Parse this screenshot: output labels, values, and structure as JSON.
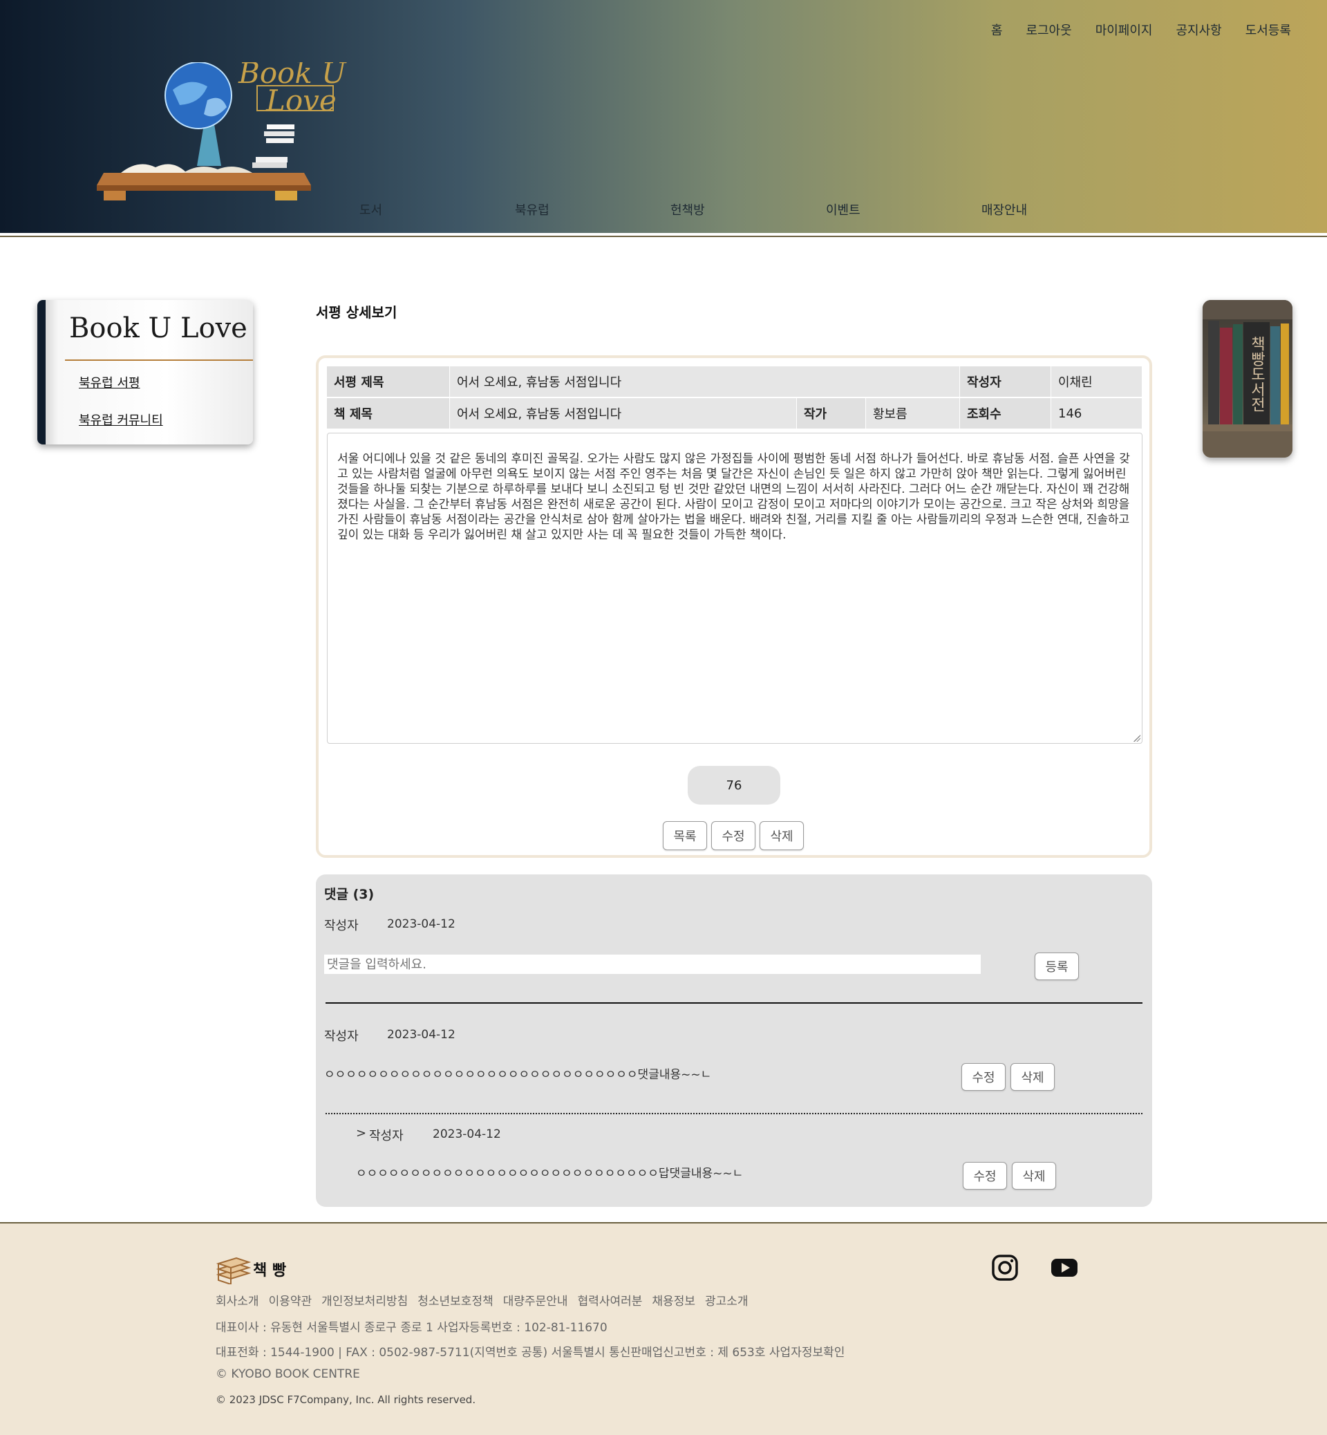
{
  "topnav": [
    "홈",
    "로그아웃",
    "마이페이지",
    "공지사항",
    "도서등록"
  ],
  "mainnav": [
    "도서",
    "북유럽",
    "헌책방",
    "이벤트",
    "매장안내"
  ],
  "logo": {
    "line1": "Book U",
    "line2": "Love"
  },
  "sidebar": {
    "title": "Book U Love",
    "items": [
      "북유럽 서평",
      "북유럽 커뮤니티"
    ]
  },
  "banner": {
    "title": "책빵도서전"
  },
  "page_title": "서평 상세보기",
  "review": {
    "review_title_label": "서평 제목",
    "review_title": "어서 오세요, 휴남동 서점입니다",
    "author_label": "작성자",
    "author": "이채린",
    "book_title_label": "책 제목",
    "book_title": "어서 오세요, 휴남동 서점입니다",
    "writer_label": "작가",
    "writer": "황보름",
    "views_label": "조회수",
    "views": "146",
    "body": "서울 어디에나 있을 것 같은 동네의 후미진 골목길. 오가는 사람도 많지 않은 가정집들 사이에 평범한 동네 서점 하나가 들어선다. 바로 휴남동 서점. 슬픈 사연을 갖고 있는 사람처럼 얼굴에 아무런 의욕도 보이지 않는 서점 주인 영주는 처음 몇 달간은 자신이 손님인 듯 일은 하지 않고 가만히 앉아 책만 읽는다. 그렇게 잃어버린 것들을 하나둘 되찾는 기분으로 하루하루를 보내다 보니 소진되고 텅 빈 것만 같았던 내면의 느낌이 서서히 사라진다. 그러다 어느 순간 깨닫는다. 자신이 꽤 건강해졌다는 사실을. 그 순간부터 휴남동 서점은 완전히 새로운 공간이 된다. 사람이 모이고 감정이 모이고 저마다의 이야기가 모이는 공간으로. 크고 작은 상처와 희망을 가진 사람들이 휴남동 서점이라는 공간을 안식처로 삼아 함께 살아가는 법을 배운다. 배려와 친절, 거리를 지킬 줄 아는 사람들끼리의 우정과 느슨한 연대, 진솔하고 깊이 있는 대화 등 우리가 잃어버린 채 살고 있지만 사는 데 꼭 필요한 것들이 가득한 책이다.",
    "likes": "76",
    "buttons": {
      "list": "목록",
      "edit": "수정",
      "delete": "삭제"
    }
  },
  "comments": {
    "title": "댓글 (3)",
    "form": {
      "author": "작성자",
      "date": "2023-04-12",
      "placeholder": "댓글을 입력하세요.",
      "submit": "등록"
    },
    "items": [
      {
        "author": "작성자",
        "date": "2023-04-12",
        "text": "ㅇㅇㅇㅇㅇㅇㅇㅇㅇㅇㅇㅇㅇㅇㅇㅇㅇㅇㅇㅇㅇㅇㅇㅇㅇㅇㅇㅇㅇ댓글내용~~ㄴ",
        "edit": "수정",
        "delete": "삭제"
      },
      {
        "prefix": ">",
        "author": "작성자",
        "date": "2023-04-12",
        "text": "ㅇㅇㅇㅇㅇㅇㅇㅇㅇㅇㅇㅇㅇㅇㅇㅇㅇㅇㅇㅇㅇㅇㅇㅇㅇㅇㅇㅇ답댓글내용~~ㄴ",
        "edit": "수정",
        "delete": "삭제"
      }
    ]
  },
  "footer": {
    "brand": "책 빵",
    "links": [
      "회사소개",
      "이용약관",
      "개인정보처리방침",
      "청소년보호정책",
      "대량주문안내",
      "협력사여러분",
      "채용정보",
      "광고소개"
    ],
    "line1": "대표이사 : 유동현 서울특별시 종로구 종로 1 사업자등록번호 : 102-81-11670",
    "line2": "대표전화 : 1544-1900 | FAX : 0502-987-5711(지역번호 공통) 서울특별시 통신판매업신고번호 : 제 653호 사업자정보확인",
    "line3": "© KYOBO BOOK CENTRE",
    "copyright": "© 2023 JDSC F7Company, Inc. All rights reserved.",
    "social": [
      "instagram-icon",
      "youtube-icon"
    ]
  },
  "colors": {
    "header_start": "#0d1a2a",
    "header_end": "#bca55a",
    "footer_bg": "#f0e6d5",
    "detail_border": "#f0e6d6",
    "comments_bg": "#e2e2e2"
  }
}
